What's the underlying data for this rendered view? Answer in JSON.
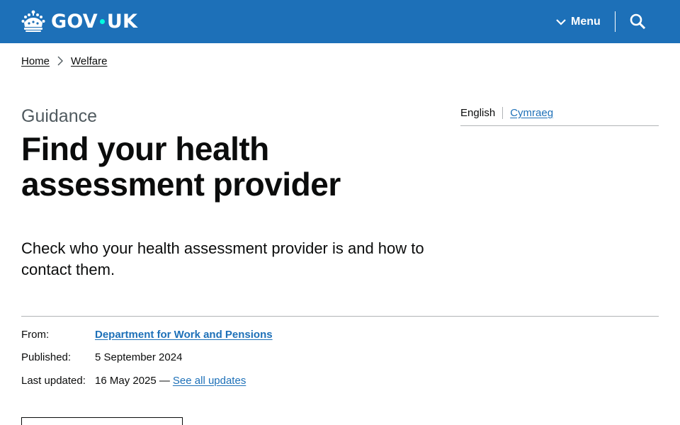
{
  "header": {
    "logo_text_left": "GOV",
    "logo_text_right": "UK",
    "menu_label": "Menu",
    "icons": {
      "logo": "crown-icon",
      "menu": "chevron-down-icon",
      "search": "search-icon"
    },
    "colors": {
      "bar": "#1d70b8",
      "dot": "#00ffe0"
    }
  },
  "breadcrumb": {
    "items": [
      "Home",
      "Welfare"
    ],
    "separator_icon": "chevron-right-icon"
  },
  "page": {
    "caption": "Guidance",
    "title": "Find your health assessment provider",
    "lead": "Check who your health assessment provider is and how to contact them."
  },
  "language": {
    "current": "English",
    "alternate": "Cymraeg"
  },
  "metadata": {
    "from_label": "From:",
    "from_value": "Department for Work and Pensions",
    "published_label": "Published:",
    "published_value": "5 September 2024",
    "updated_label": "Last updated:",
    "updated_value": "16 May 2025 —",
    "updated_link": "See all updates"
  },
  "colors": {
    "link": "#1d70b8",
    "text": "#0b0c0c",
    "secondary": "#505a5f",
    "border": "#b1b4b6"
  }
}
